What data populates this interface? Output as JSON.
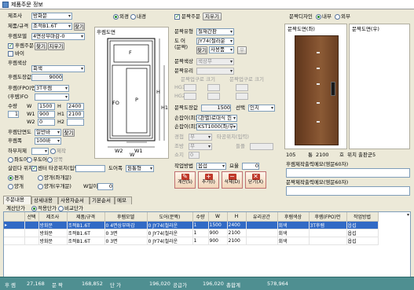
{
  "window": {
    "title": "제품주문 정보"
  },
  "left": {
    "maker_label": "제조사",
    "maker_value": "방화문",
    "product_label": "제품/규격",
    "product_value": "조적B1.6T",
    "product_btn": "찾기",
    "mold_label": "후렘모델",
    "mold_value": "4면상부마감-0",
    "entry_check_label": "후렘주문",
    "entry_btn1": "찾기",
    "entry_btn2": "지우기",
    "bar_label": "바이",
    "color_label": "후렘색상",
    "color_value": "회색",
    "price_label": "후렘도장값",
    "price_value": "9000",
    "fpo_label": "후렘(FPO)먼",
    "fpo_value": "3T후렘",
    "fpo2_label": "(후렘)FO",
    "qty_label": "수량",
    "qty_value": "1",
    "w_label": "W",
    "w_value": "1500",
    "h_label": "H",
    "h_value": "2400",
    "w1_label": "W1",
    "w1_value": "900",
    "h1_label": "H1",
    "h1_value": "2100",
    "w2_label": "W2",
    "w2_value": "0",
    "h2_label": "H2",
    "hinge_label": "후렘단면도",
    "hinge_value": "일반바",
    "hinge_btn": "찾기",
    "frame2_label": "후렘폭",
    "frame2_value": "100바",
    "jig_label": "하부처제",
    "jig_value": "제작",
    "left_right_label": "좌도어",
    "left_right_value": "우도어",
    "both_label": "양쪽",
    "sill_label": "살린다 위치",
    "sill_value": "센터",
    "opening_label": "타공위치(입력)",
    "door_label": "도어폭",
    "door_value": "원통형",
    "opt1_label": "편개",
    "opt2_label": "양개(좌개문)",
    "opt3_label": "양개",
    "opt4_label": "양개(우개문)",
    "wsum_label": "W일이",
    "wsum_value": "0"
  },
  "diagram": {
    "radio_out": "외경",
    "radio_in": "내경",
    "title": "후렘도면",
    "w_tag": "W",
    "w1_tag": "W1",
    "w2_tag": "W2",
    "h_tag": "H",
    "h1_tag": "H1",
    "p_tag": "P",
    "f_tag": "F",
    "fo_tag": "FO"
  },
  "middle": {
    "door_order_label": "문짝주문",
    "clear_btn": "지우기",
    "door_spec_label": "문짝유형",
    "door_spec_value": "철재간판",
    "do_label": "도 어",
    "do_value": "JY74(철라운",
    "find_btn": "찾기",
    "std_value": "사용품",
    "desc_label": "(문짝)",
    "btn_u": "우",
    "door_color_label": "문짝색상",
    "door_color_value": "색상무",
    "door_mat_label": "문짝유리",
    "glass_in_label": "문짝업구로 크기",
    "glass_out_label": "문짝업구로 크기",
    "hg1_label": "HG1",
    "hg2_label": "HG2",
    "door_price_label": "문짝도장값",
    "door_price_value": "1500",
    "select_label": "선택",
    "select_value": "인치",
    "handle_label": "손잡이(최)",
    "handle_value": "(관별)로대식 힌",
    "lock_label": "손잡이(최)",
    "lock_value": "KST1000(좌/우",
    "hw1_label": "경첩",
    "hw1_value": "무",
    "hw1b_label": "타공위치(입력)",
    "hw2_label": "조방",
    "hw2_value": "무",
    "hw3_label": "들플",
    "hw4_label": "쇼지",
    "hw4_value": "0",
    "work_label": "작업방법",
    "work_value": "옵섭",
    "ratio_label": "요율",
    "ratio_value": "0",
    "btn_calc": "계산(S)",
    "btn_add": "추가(I)",
    "btn_del": "삭제(D)",
    "btn_close": "닫기(X)"
  },
  "right": {
    "door_dir_label": "문짝디자인",
    "dir_in": "내부",
    "dir_out": "외부",
    "img1_title": "문짝도면(좌)",
    "img2_title": "문짝도면(우)",
    "dim_left": "105",
    "dim_mid_label": "통",
    "dim_mid_value": "2100",
    "dim_right_label": "호",
    "dim_right2": "위치",
    "dim_right_value": "출판군5",
    "remark1_label": "후렘제작출력메모(영문60자)",
    "remark2_label": "문짝제작출력메모(영문60자)"
  },
  "tabs": [
    "주문내용",
    "상세내용",
    "사용자순서",
    "기본순서",
    "메모"
  ],
  "grid": {
    "calc_label": "계산단가",
    "calc_opt1": "적용단가",
    "calc_opt2": "비교단가",
    "headers": [
      "",
      "선택",
      "제조사",
      "제품/규격",
      "후렘모델",
      "도어(문짝)",
      "수량",
      "W",
      "H",
      "유리공간",
      "후렘색상",
      "후렘(FPO)먼",
      "작업방법"
    ],
    "rows": [
      [
        "▸",
        "",
        "방화문",
        "조적B1.6T",
        "0 4면상부마감",
        "0 JY74(철라운",
        "1",
        "1500",
        "2400",
        "",
        "회색",
        "3T후렘",
        "옵섭"
      ],
      [
        "",
        "",
        "방화문",
        "조적B1.6T",
        "0 3면",
        "0 JY74(철라운",
        "1",
        "900",
        "2100",
        "",
        "회색",
        "",
        "옵섭"
      ],
      [
        "",
        "",
        "방화문",
        "조적B1.6T",
        "0 3면",
        "0 JY74(철라운",
        "1",
        "900",
        "2100",
        "",
        "회색",
        "",
        "옵섭"
      ]
    ]
  },
  "summary": {
    "s1_label": "후 렘",
    "s1_value": "27,168",
    "s2_label": "문 짝",
    "s2_value": "168,852",
    "s3_label": "단 가",
    "s3_value": "196,020",
    "s4_label": "공급가",
    "s4_value": "196,020",
    "s5_label": "총합계",
    "s5_value": "578,964"
  },
  "colors": {
    "summary_bar": "#4f8f91",
    "selected_row": "#316ac5",
    "door_wood": "#7a4a2a"
  }
}
